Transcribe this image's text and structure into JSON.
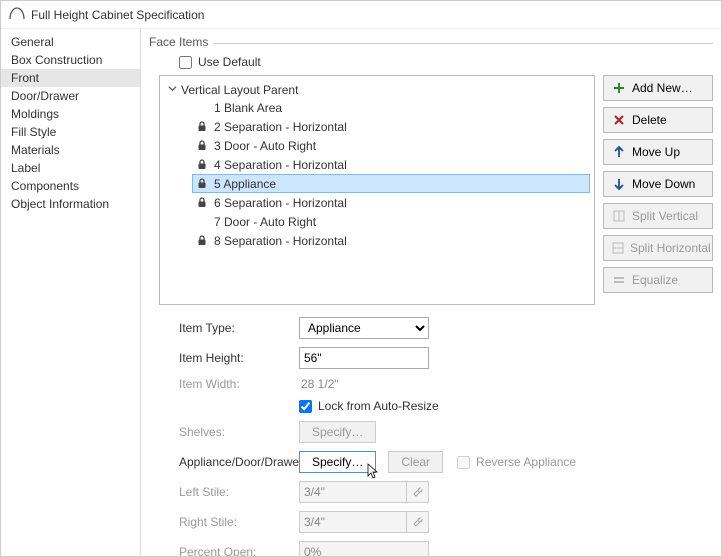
{
  "window": {
    "title": "Full Height Cabinet Specification"
  },
  "sidebar": {
    "items": [
      {
        "label": "General"
      },
      {
        "label": "Box Construction"
      },
      {
        "label": "Front",
        "selected": true
      },
      {
        "label": "Door/Drawer"
      },
      {
        "label": "Moldings"
      },
      {
        "label": "Fill Style"
      },
      {
        "label": "Materials"
      },
      {
        "label": "Label"
      },
      {
        "label": "Components"
      },
      {
        "label": "Object Information"
      }
    ]
  },
  "face_items": {
    "legend": "Face Items",
    "use_default_label": "Use Default",
    "root_label": "Vertical Layout Parent",
    "items": [
      {
        "locked": false,
        "label": "1 Blank Area"
      },
      {
        "locked": true,
        "label": "2 Separation - Horizontal"
      },
      {
        "locked": true,
        "label": "3 Door - Auto Right"
      },
      {
        "locked": true,
        "label": "4 Separation - Horizontal"
      },
      {
        "locked": true,
        "label": "5 Appliance",
        "selected": true
      },
      {
        "locked": true,
        "label": "6 Separation - Horizontal"
      },
      {
        "locked": false,
        "label": "7 Door - Auto Right"
      },
      {
        "locked": true,
        "label": "8 Separation - Horizontal"
      }
    ]
  },
  "side_buttons": {
    "add_new": "Add New…",
    "delete": "Delete",
    "move_up": "Move Up",
    "move_down": "Move Down",
    "split_vertical": "Split Vertical",
    "split_horizontal": "Split Horizontal",
    "equalize": "Equalize"
  },
  "form": {
    "item_type_label": "Item Type:",
    "item_type_value": "Appliance",
    "item_height_label": "Item Height:",
    "item_height_value": "56\"",
    "item_width_label": "Item Width:",
    "item_width_value": "28 1/2\"",
    "lock_label": "Lock from Auto-Resize",
    "shelves_label": "Shelves:",
    "shelves_button": "Specify…",
    "add_label": "Appliance/Door/Drawer:",
    "specify_button": "Specify…",
    "clear_button": "Clear",
    "reverse_label": "Reverse Appliance",
    "left_stile_label": "Left Stile:",
    "left_stile_value": "3/4\"",
    "right_stile_label": "Right Stile:",
    "right_stile_value": "3/4\"",
    "percent_open_label": "Percent Open:",
    "percent_open_value": "0%"
  },
  "colors": {
    "add_green": "#2a8a2a",
    "delete_red": "#b02020",
    "arrow_blue": "#1a4fa0",
    "selection_bg": "#cce6ff",
    "selection_border": "#7abaff"
  }
}
